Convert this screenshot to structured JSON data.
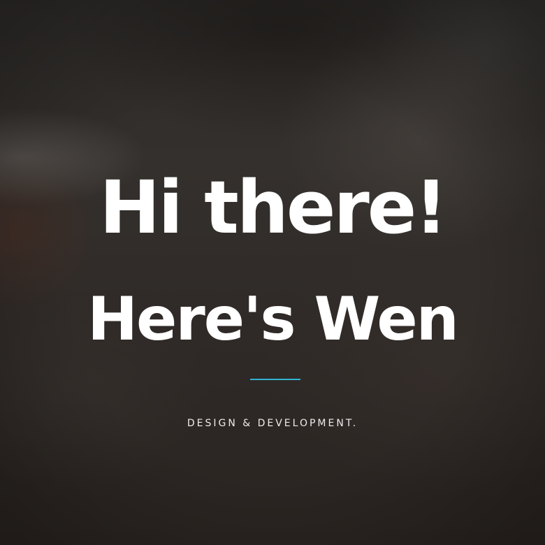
{
  "hero": {
    "title_line1": "Hi there!",
    "title_line2": "Here's Wen",
    "tagline": "DESIGN & DEVELOPMENT.",
    "colors": {
      "accent": "#2fb3d1",
      "text": "#ffffff",
      "background": "#2e2a27"
    }
  }
}
